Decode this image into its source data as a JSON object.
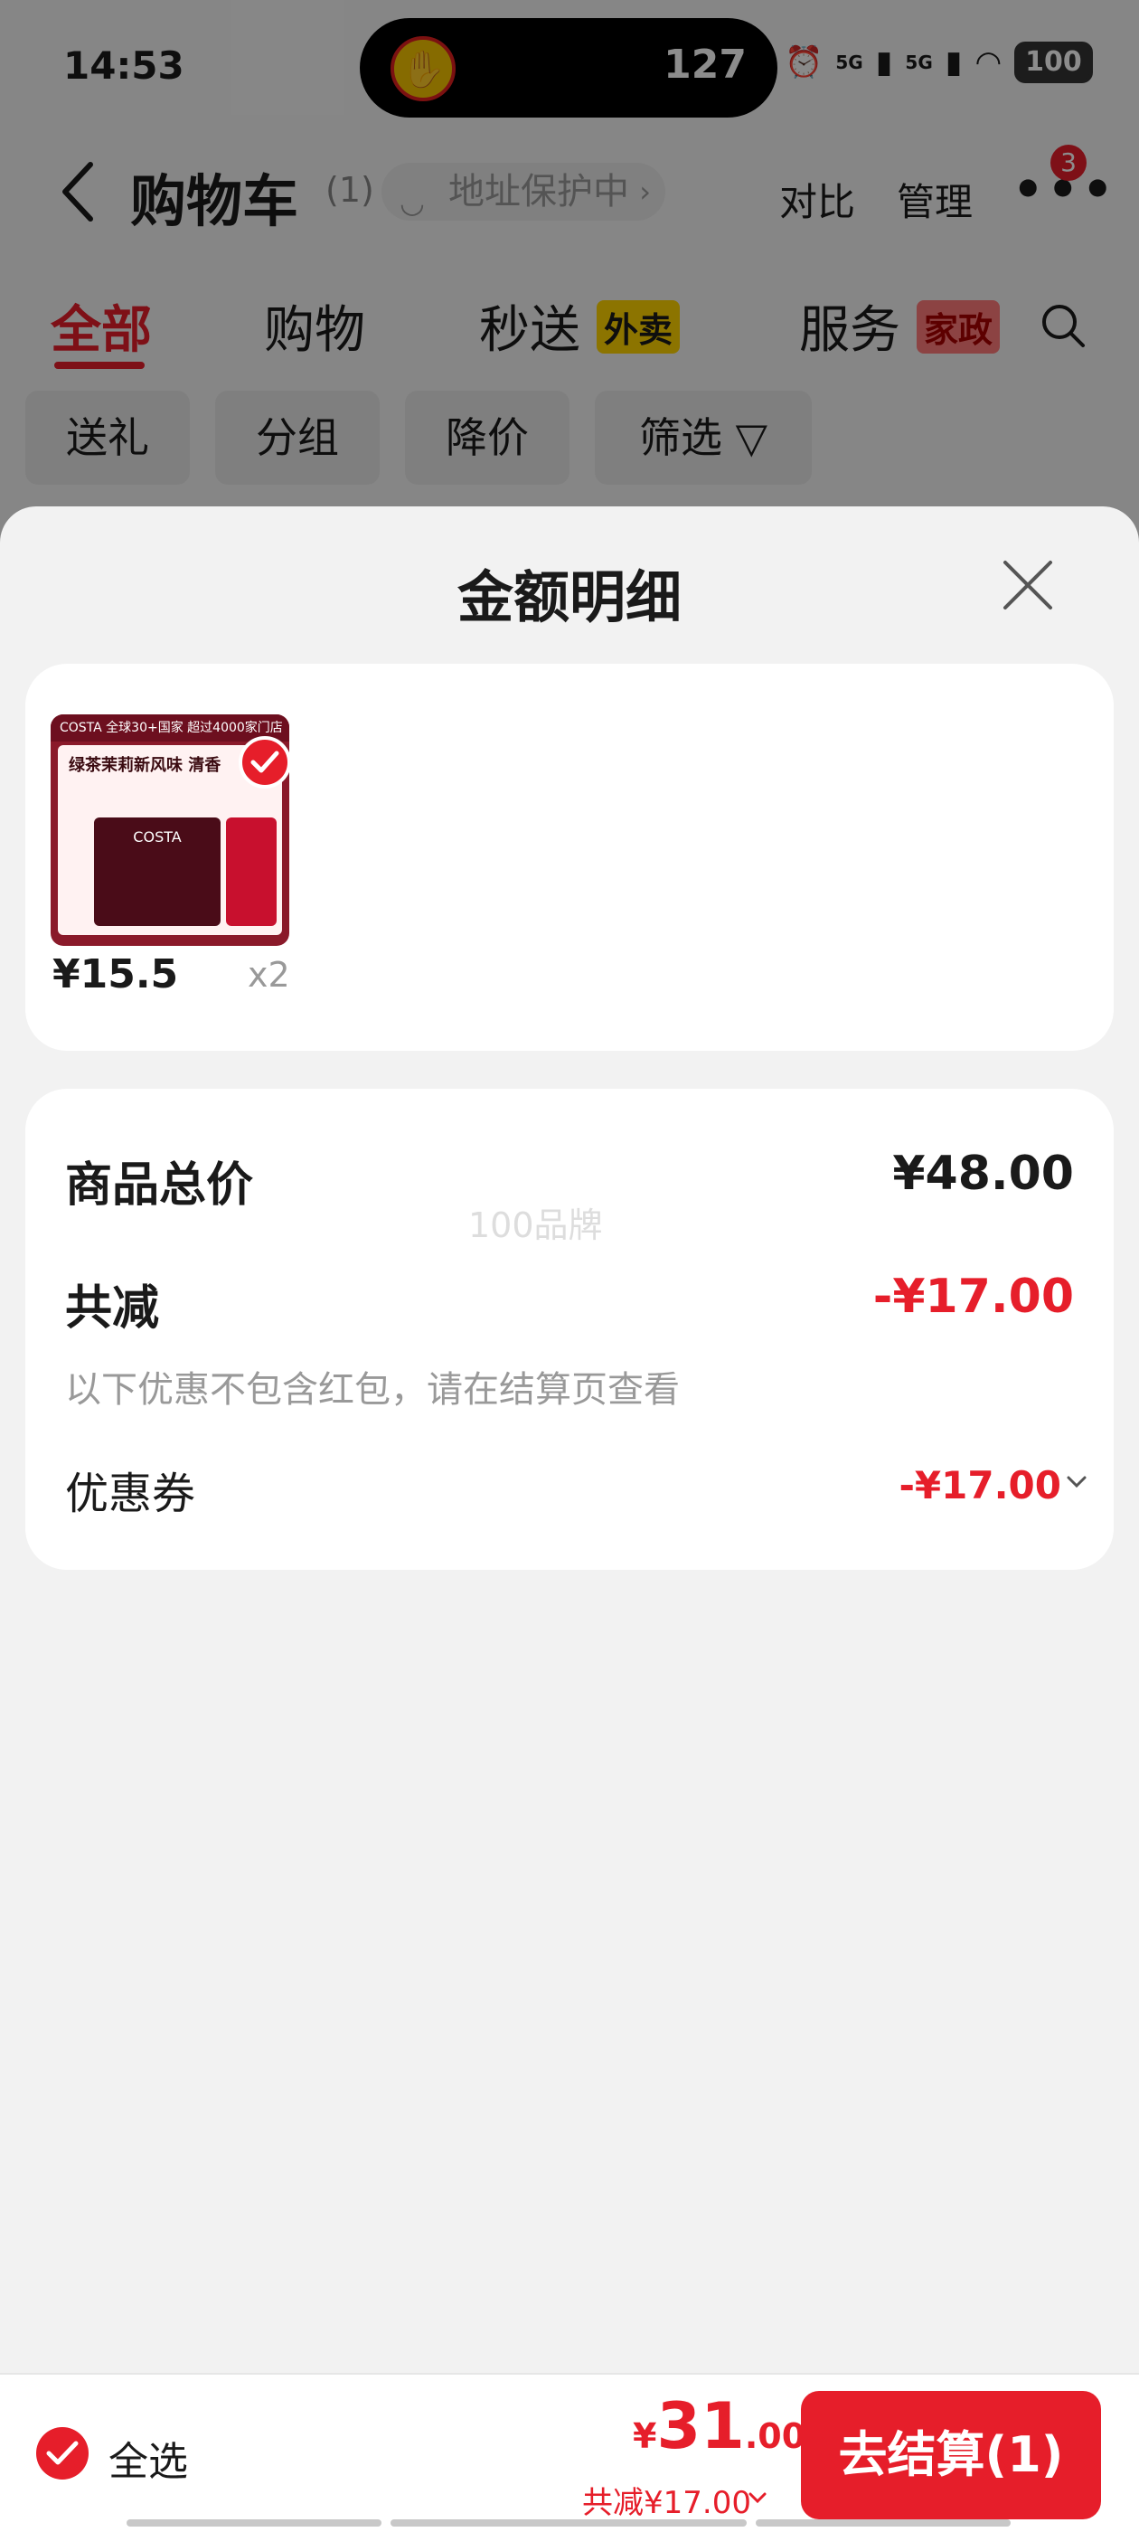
{
  "status_bar": {
    "time": "14:53",
    "island_number": "127",
    "signal_1": "5G",
    "signal_2": "5G",
    "battery": "100"
  },
  "nav": {
    "title": "购物车",
    "count": "(1)",
    "address_protection": "地址保护中",
    "compare": "对比",
    "manage": "管理",
    "more_badge": "3"
  },
  "tabs": [
    {
      "label": "全部",
      "active": true
    },
    {
      "label": "购物"
    },
    {
      "label": "秒送",
      "tag": "外卖"
    },
    {
      "label": "服务",
      "tag": "家政"
    }
  ],
  "chips": [
    "送礼",
    "分组",
    "降价",
    "筛选"
  ],
  "sheet": {
    "title": "金额明细",
    "product": {
      "thumb_top": "COSTA  全球30+国家 超过4000家门店",
      "thumb_head": "绿茶茉莉新风味 清香",
      "thumb_brand": "COSTA",
      "price": "¥15.5",
      "qty": "x2"
    },
    "summary": {
      "total_label": "商品总价",
      "total_value": "¥48.00",
      "discount_label": "共减",
      "discount_value": "-¥17.00",
      "note": "以下优惠不包含红包，请在结算页查看",
      "coupon_label": "优惠券",
      "coupon_value": "-¥17.00",
      "watermark": "100品牌"
    }
  },
  "bottom_bar": {
    "select_all": "全选",
    "total_yen": "¥",
    "total_int": "31",
    "total_dec": ".00",
    "discount_summary": "共减¥17.00",
    "checkout": "去结算(1)"
  },
  "colors": {
    "accent": "#e61e2a",
    "badge_yellow": "#ffd400"
  }
}
